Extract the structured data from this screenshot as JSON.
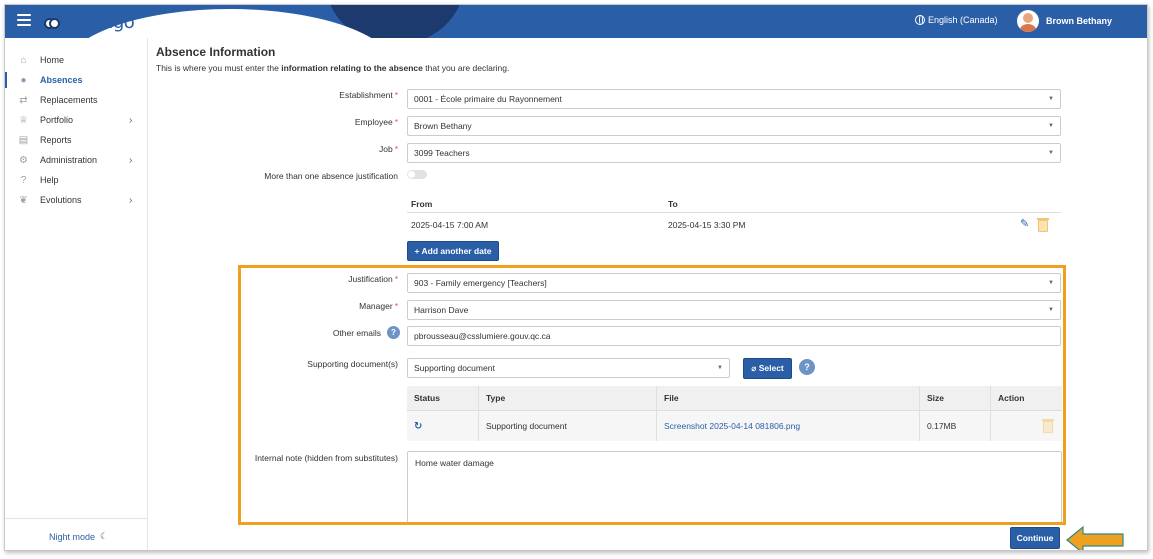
{
  "header": {
    "app_name": "Scolago",
    "language": "English (Canada)",
    "user_name": "Brown Bethany"
  },
  "sidebar": {
    "items": [
      {
        "label": "Home",
        "icon": "home-icon"
      },
      {
        "label": "Absences",
        "icon": "user-clock-icon",
        "active": true
      },
      {
        "label": "Replacements",
        "icon": "swap-icon"
      },
      {
        "label": "Portfolio",
        "icon": "trophy-icon",
        "has_submenu": true
      },
      {
        "label": "Reports",
        "icon": "document-icon"
      },
      {
        "label": "Administration",
        "icon": "gear-icon",
        "has_submenu": true
      },
      {
        "label": "Help",
        "icon": "question-icon"
      },
      {
        "label": "Evolutions",
        "icon": "sprout-icon",
        "has_submenu": true
      }
    ],
    "night_mode": "Night mode"
  },
  "page": {
    "title": "Absence Information",
    "subtitle_pre": "This is where you must enter the ",
    "subtitle_bold": "information relating to the absence",
    "subtitle_post": " that you are declaring."
  },
  "form": {
    "establishment_label": "Establishment",
    "establishment_value": "0001 - École primaire du Rayonnement",
    "employee_label": "Employee",
    "employee_value": "Brown Bethany",
    "job_label": "Job",
    "job_value": "3099 Teachers",
    "multi_justification_label": "More than one absence justification",
    "dates": {
      "from_header": "From",
      "to_header": "To",
      "rows": [
        {
          "from": "2025-04-15 7:00 AM",
          "to": "2025-04-15 3:30 PM"
        }
      ]
    },
    "add_date_label": "Add another date",
    "justification_label": "Justification",
    "justification_value": "903 - Family emergency [Teachers]",
    "manager_label": "Manager",
    "manager_value": "Harrison Dave",
    "other_emails_label": "Other emails",
    "other_emails_value": "pbrousseau@csslumiere.gouv.qc.ca",
    "supporting_docs_label": "Supporting document(s)",
    "supporting_docs_value": "Supporting document",
    "select_button": "Select",
    "doc_table": {
      "headers": [
        "Status",
        "Type",
        "File",
        "Size",
        "Action"
      ],
      "rows": [
        {
          "type": "Supporting document",
          "file": "Screenshot 2025-04-14 081806.png",
          "size": "0.17MB"
        }
      ]
    },
    "internal_note_label": "Internal note (hidden from substitutes)",
    "internal_note_value": "Home water damage",
    "continue_button": "Continue"
  },
  "colors": {
    "brand": "#2a5fa8",
    "highlight": "#f0a020",
    "arrow": "#f0a020"
  }
}
